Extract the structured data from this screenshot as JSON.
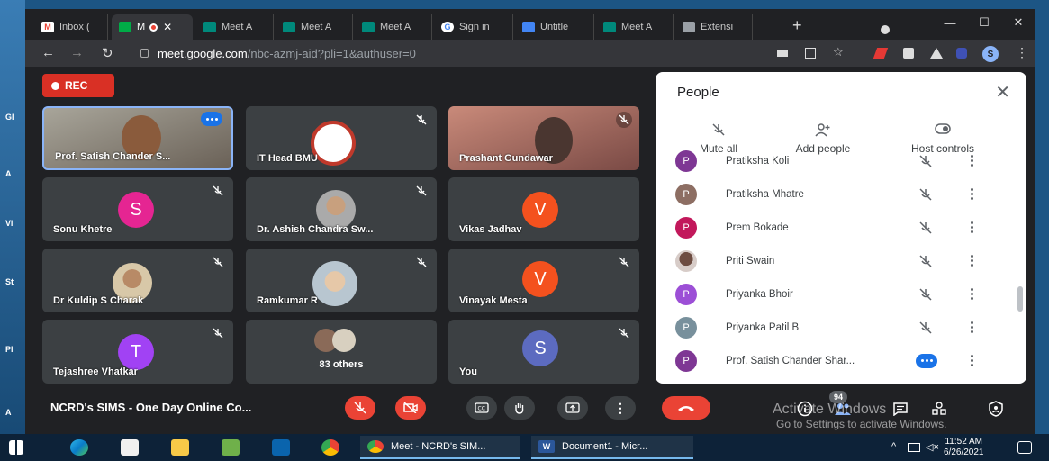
{
  "desktop": {
    "left_labels": [
      "Gl",
      "A",
      "Vi",
      "St",
      "Pl",
      "A"
    ]
  },
  "browser": {
    "tabs": [
      {
        "label": "Inbox (",
        "favicon": "gmail-icon",
        "color": "#ea4335"
      },
      {
        "label": "M",
        "favicon": "meet-icon",
        "color": "#00ac47",
        "active": true
      },
      {
        "label": "Meet A",
        "favicon": "meet-icon",
        "color": "#00897b"
      },
      {
        "label": "Meet A",
        "favicon": "meet-icon",
        "color": "#00897b"
      },
      {
        "label": "Meet A",
        "favicon": "meet-icon",
        "color": "#00897b"
      },
      {
        "label": "Sign in",
        "favicon": "google-icon",
        "color": "#4285f4"
      },
      {
        "label": "Untitle",
        "favicon": "docs-icon",
        "color": "#4285f4"
      },
      {
        "label": "Meet A",
        "favicon": "meet-icon",
        "color": "#00897b"
      },
      {
        "label": "Extensi",
        "favicon": "puzzle-icon",
        "color": "#9aa0a6"
      }
    ],
    "url_host": "meet.google.com",
    "url_path": "/nbc-azmj-aid?pli=1&authuser=0",
    "profile_initial": "S"
  },
  "meet": {
    "rec_label": "REC",
    "tiles": [
      {
        "name": "Prof. Satish Chander S...",
        "type": "video",
        "pinned": true
      },
      {
        "name": "IT Head BMU",
        "type": "logo"
      },
      {
        "name": "Prashant Gundawar",
        "type": "video"
      },
      {
        "name": "Sonu Khetre",
        "type": "letter",
        "letter": "S",
        "color": "#e52592"
      },
      {
        "name": "Dr. Ashish Chandra Sw...",
        "type": "photo"
      },
      {
        "name": "Vikas Jadhav",
        "type": "letter",
        "letter": "V",
        "color": "#f4511e"
      },
      {
        "name": "Dr Kuldip S Charak",
        "type": "photo"
      },
      {
        "name": "Ramkumar R",
        "type": "photo"
      },
      {
        "name": "Vinayak Mesta",
        "type": "letter",
        "letter": "V",
        "color": "#f4511e"
      },
      {
        "name": "Tejashree Vhatkar",
        "type": "letter",
        "letter": "T",
        "color": "#a142f4"
      },
      {
        "name": "83 others",
        "type": "others"
      },
      {
        "name": "You",
        "type": "letter",
        "letter": "S",
        "color": "#5c6bc0"
      }
    ],
    "meeting_name": "NCRD's SIMS - One Day Online Co...",
    "participant_badge": "94"
  },
  "people_panel": {
    "title": "People",
    "actions": [
      {
        "label": "Mute all",
        "icon": "mute-icon"
      },
      {
        "label": "Add people",
        "icon": "add-person-icon"
      },
      {
        "label": "Host controls",
        "icon": "toggle-icon"
      }
    ],
    "participants": [
      {
        "initial": "P",
        "name": "Pratiksha Koli",
        "color": "#7e3794"
      },
      {
        "initial": "P",
        "name": "Pratiksha Mhatre",
        "color": "#8d6e63"
      },
      {
        "initial": "P",
        "name": "Prem Bokade",
        "color": "#c2185b"
      },
      {
        "initial": "",
        "name": "Priti Swain",
        "color": "#5d4037"
      },
      {
        "initial": "P",
        "name": "Priyanka Bhoir",
        "color": "#9c4fd6"
      },
      {
        "initial": "P",
        "name": "Priyanka Patil B",
        "color": "#78909c"
      },
      {
        "initial": "P",
        "name": "Prof. Satish Chander Shar...",
        "color": "#7e3794",
        "host": true
      }
    ]
  },
  "watermark": {
    "line1": "Activate Windows",
    "line2": "Go to Settings to activate Windows."
  },
  "taskbar": {
    "apps": [
      {
        "label": "Meet - NCRD's SIM...",
        "icon": "chrome-meet-icon"
      },
      {
        "label": "Document1 - Micr...",
        "icon": "word-icon"
      }
    ],
    "time": "11:52 AM",
    "date": "6/26/2021"
  }
}
